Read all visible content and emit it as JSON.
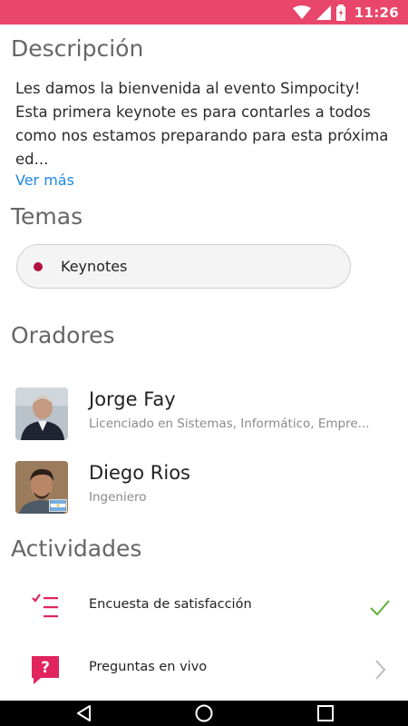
{
  "status_bar": {
    "time": "11:26",
    "color": "#e8466a"
  },
  "description": {
    "title": "Descripción",
    "text": "Les damos la bienvenida al evento Simpocity! Esta primera keynote es para contarles a todos como nos estamos preparando para esta próxima ed...",
    "more_link": "Ver más"
  },
  "topics": {
    "title": "Temas",
    "items": [
      {
        "label": "Keynotes",
        "color": "#b0123e"
      }
    ]
  },
  "speakers": {
    "title": "Oradores",
    "items": [
      {
        "name": "Jorge Fay",
        "subtitle": "Licenciado en Sistemas, Informático, Empre..."
      },
      {
        "name": "Diego Rios",
        "subtitle": "Ingeniero",
        "flag": "argentina-flag-icon"
      }
    ]
  },
  "activities": {
    "title": "Actividades",
    "items": [
      {
        "label": "Encuesta de satisfacción",
        "icon": "checklist-icon",
        "end_icon": "checkmark-icon"
      },
      {
        "label": "Preguntas en vivo",
        "icon": "question-bubble-icon",
        "end_icon": "chevron-right-icon"
      }
    ]
  },
  "nav_bar": {
    "buttons": [
      "back-icon",
      "home-icon",
      "recents-icon"
    ]
  },
  "accent_color": "#e0245e"
}
